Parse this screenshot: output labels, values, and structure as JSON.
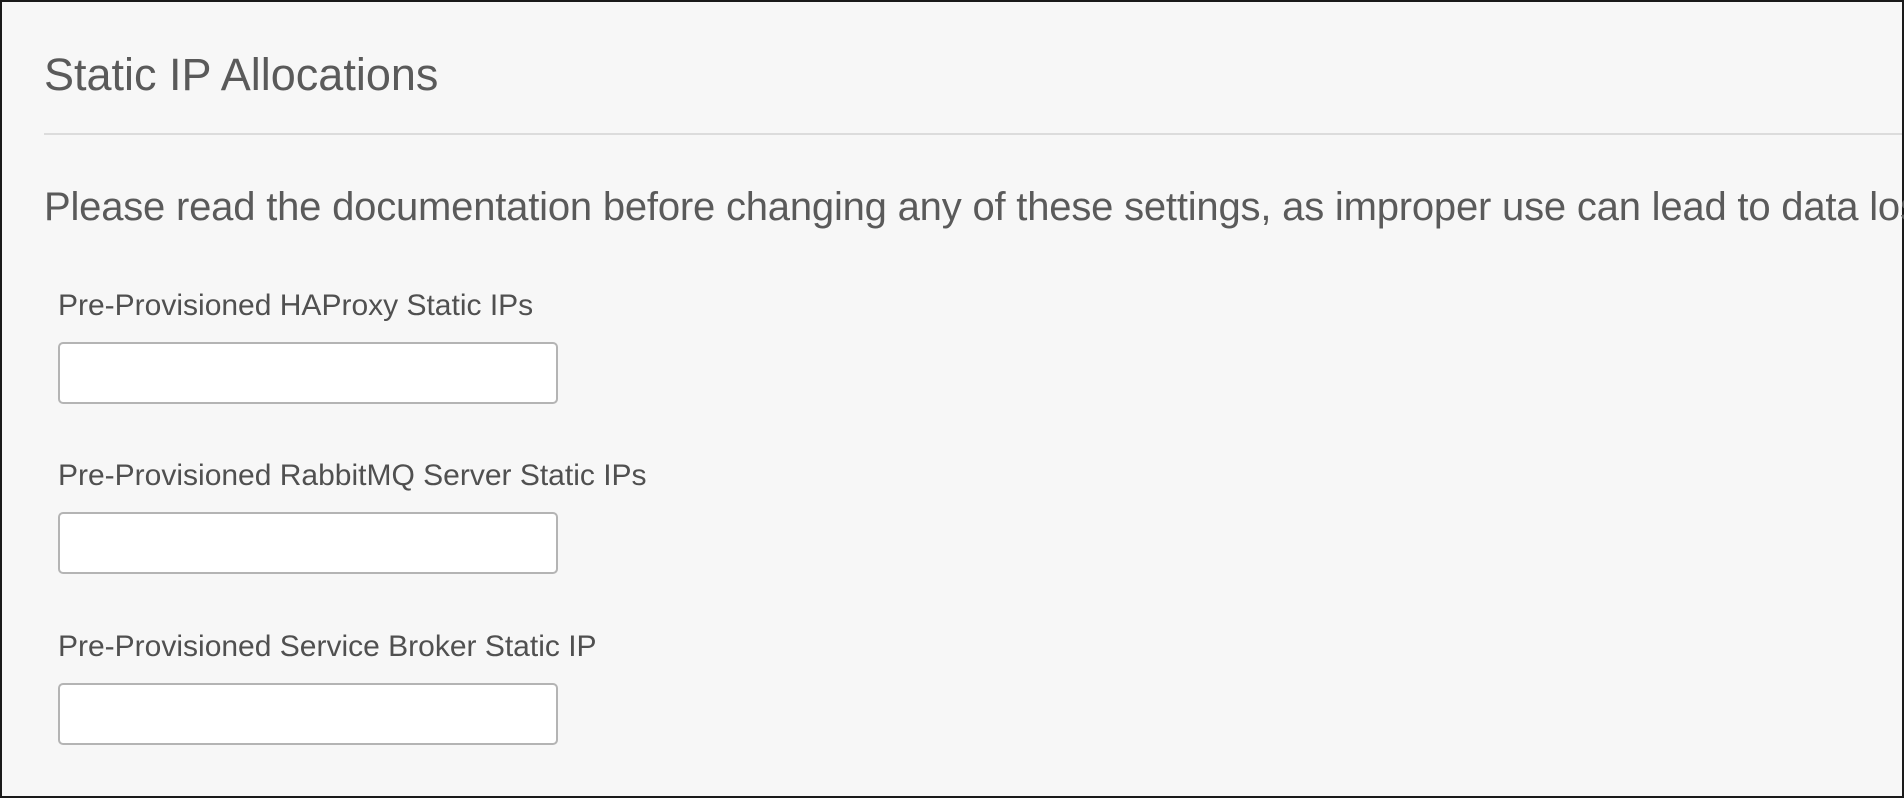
{
  "section": {
    "title": "Static IP Allocations",
    "warning": "Please read the documentation before changing any of these settings, as improper use can lead to data loss."
  },
  "fields": [
    {
      "label": "Pre-Provisioned HAProxy Static IPs",
      "value": "",
      "placeholder": ""
    },
    {
      "label": "Pre-Provisioned RabbitMQ Server Static IPs",
      "value": "",
      "placeholder": ""
    },
    {
      "label": "Pre-Provisioned Service Broker Static IP",
      "value": "",
      "placeholder": ""
    }
  ],
  "colors": {
    "panel_background": "#f7f7f7",
    "panel_border": "#1a1a1a",
    "divider": "#dcdcdc",
    "input_border": "#b4b4b4",
    "text": "#5a5a5a"
  }
}
